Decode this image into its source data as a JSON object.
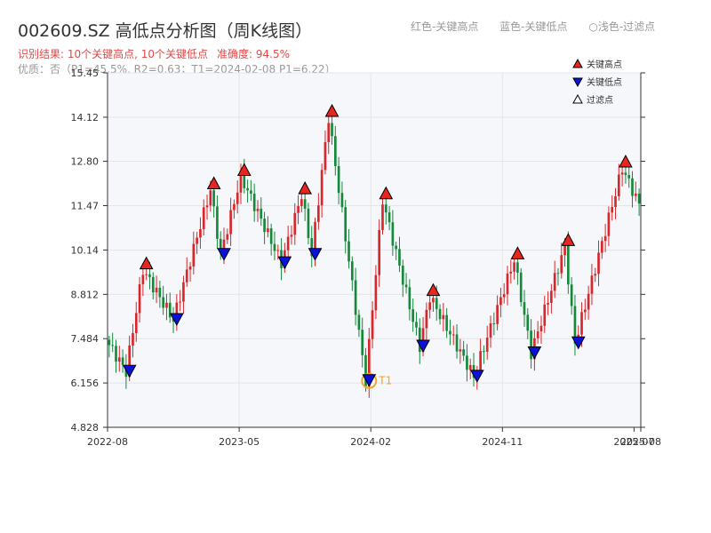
{
  "title": "002609.SZ 高低点分析图（周K线图）",
  "legend_top": [
    "红色-关键高点",
    "蓝色-关键低点",
    "○浅色-过滤点"
  ],
  "subtitle_result": "识别结果: 10个关键高点, 10个关键低点",
  "subtitle_accuracy": "准确度: 94.5%",
  "subtitle_quality": "优质：否（P1=45.5%, R2=0.63；T1=2024-02-08 P1=6.22）",
  "colors": {
    "up": "#d9262a",
    "down": "#15893a",
    "high_marker": "#e8251f",
    "low_marker": "#0a12d8",
    "t1_ring": "#f5a623",
    "grid": "#e2e6ec",
    "plot_bg": "#f5f7fa"
  },
  "chart_data": {
    "type": "candlestick",
    "title": "002609.SZ 高低点分析图（周K线图）",
    "ylim": [
      4.828,
      15.45
    ],
    "y_ticks": [
      "4.828",
      "6.156",
      "7.484",
      "8.812",
      "10.14",
      "11.47",
      "12.80",
      "14.12",
      "15.45"
    ],
    "x_ticks": [
      "2022-08",
      "2023-05",
      "2024-02",
      "2024-11",
      "2025-07",
      "2025-08"
    ],
    "x_tick_positions": [
      0,
      39,
      78,
      117,
      156,
      158
    ],
    "weeks_total": 158,
    "legend": [
      "关键高点",
      "关键低点",
      "过滤点"
    ],
    "key_highs": [
      {
        "week": 11,
        "price": 9.55
      },
      {
        "week": 31,
        "price": 11.95
      },
      {
        "week": 40,
        "price": 12.35
      },
      {
        "week": 58,
        "price": 11.8
      },
      {
        "week": 66,
        "price": 14.12
      },
      {
        "week": 82,
        "price": 11.65
      },
      {
        "week": 96,
        "price": 8.75
      },
      {
        "week": 121,
        "price": 9.85
      },
      {
        "week": 136,
        "price": 10.25
      },
      {
        "week": 153,
        "price": 12.6
      }
    ],
    "key_lows": [
      {
        "week": 6,
        "price": 6.5
      },
      {
        "week": 20,
        "price": 8.05
      },
      {
        "week": 34,
        "price": 10.0
      },
      {
        "week": 52,
        "price": 9.75
      },
      {
        "week": 61,
        "price": 10.0
      },
      {
        "week": 77,
        "price": 6.22
      },
      {
        "week": 93,
        "price": 7.25
      },
      {
        "week": 109,
        "price": 6.35
      },
      {
        "week": 126,
        "price": 7.05
      },
      {
        "week": 139,
        "price": 7.35
      }
    ],
    "t1": {
      "label": "T1",
      "week": 77,
      "price": 6.22
    }
  }
}
